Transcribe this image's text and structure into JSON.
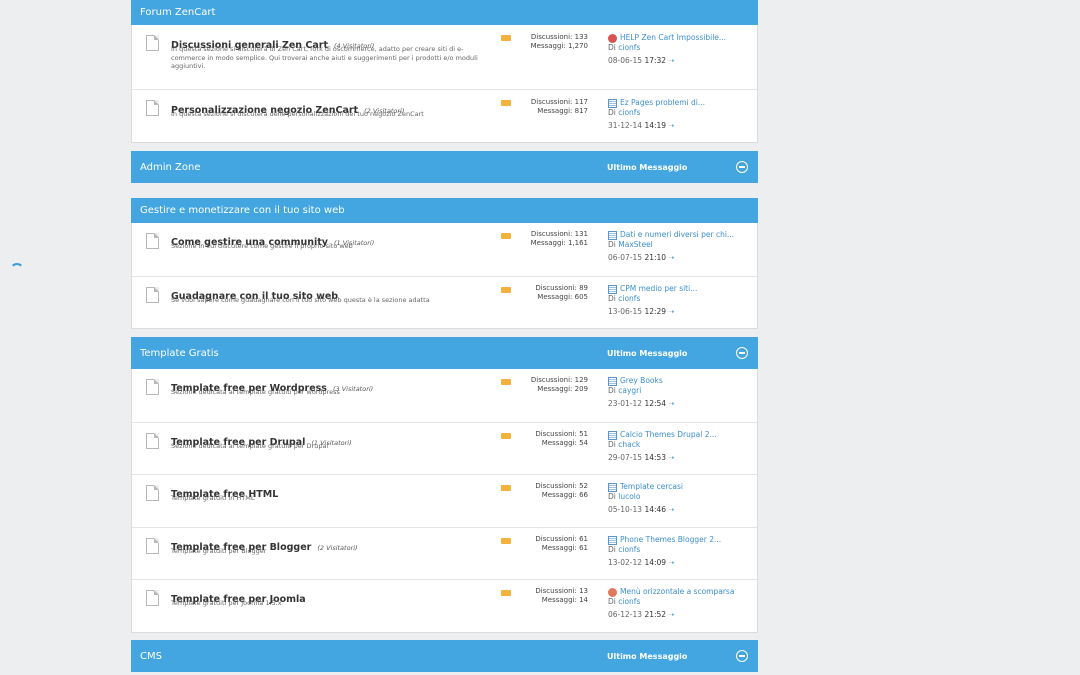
{
  "sections": [
    {
      "title": "Forum ZenCart",
      "last_label": "",
      "forums": [
        {
          "name": "Discussioni generali Zen Cart",
          "visitors": "(4 Visitatori)",
          "desc": "In questa sezione si discuterà di Zen Cart, fork di oscommerce, adatto per creare siti di e-commerce in modo semplice. Qui troverai anche aiuti e suggerimenti per i prodotti e/o moduli aggiuntivi.",
          "discussions": "Discussioni: 133",
          "messages": "Messaggi: 1,270",
          "last_icon": "alert-icon",
          "last_title": "HELP Zen Cart Impossibile...",
          "last_by_prefix": "Di",
          "last_user": "cionfs",
          "last_date": "08-06-15",
          "last_time": "17:32"
        },
        {
          "name": "Personalizzazione negozio ZenCart",
          "visitors": "(2 Visitatori)",
          "desc": "In questa sezione si discuterà delle personalizzazioni del tuo negozio ZenCart",
          "discussions": "Discussioni: 117",
          "messages": "Messaggi: 817",
          "last_icon": "document-icon",
          "last_title": "Ez Pages problemi di...",
          "last_by_prefix": "Di",
          "last_user": "cionfs",
          "last_date": "31-12-14",
          "last_time": "14:19"
        }
      ]
    },
    {
      "title": "Admin Zone",
      "last_label": "Ultimo Messaggio",
      "forums": []
    },
    {
      "title": "Gestire e monetizzare con il tuo sito web",
      "last_label": "",
      "forums": [
        {
          "name": "Come gestire una community",
          "visitors": "(1 Visitatori)",
          "desc": "Sezione in cui discutere come gestire il proprio sito web",
          "discussions": "Discussioni: 131",
          "messages": "Messaggi: 1,161",
          "last_icon": "document-icon",
          "last_title": "Dati e numeri diversi per chi...",
          "last_by_prefix": "Di",
          "last_user": "MaxSteel",
          "last_date": "06-07-15",
          "last_time": "21:10"
        },
        {
          "name": "Guadagnare con il tuo sito web",
          "visitors": "",
          "desc": "Se vuoi sapere come guadagnare con il tuo sito web questa è la sezione adatta",
          "discussions": "Discussioni: 89",
          "messages": "Messaggi: 605",
          "last_icon": "document-icon",
          "last_title": "CPM medio per siti...",
          "last_by_prefix": "Di",
          "last_user": "cionfs",
          "last_date": "13-06-15",
          "last_time": "12:29"
        }
      ]
    },
    {
      "title": "Template Gratis",
      "last_label": "Ultimo Messaggio",
      "forums": [
        {
          "name": "Template free per Wordpress",
          "visitors": "(3 Visitatori)",
          "desc": "Sezione dedicata ai template gratuiti per wordpress",
          "discussions": "Discussioni: 129",
          "messages": "Messaggi: 209",
          "last_icon": "document-icon",
          "last_title": "Grey Books",
          "last_by_prefix": "Di",
          "last_user": "caygri",
          "last_date": "23-01-12",
          "last_time": "12:54"
        },
        {
          "name": "Template free per Drupal",
          "visitors": "(1 Visitatori)",
          "desc": "Sezione dedicata ai template gratuiti per Drupal",
          "discussions": "Discussioni: 51",
          "messages": "Messaggi: 54",
          "last_icon": "document-icon",
          "last_title": "Calcio Themes Drupal 2...",
          "last_by_prefix": "Di",
          "last_user": "chack",
          "last_date": "29-07-15",
          "last_time": "14:53"
        },
        {
          "name": "Template free HTML",
          "visitors": "",
          "desc": "Template gratuiti in HTML",
          "discussions": "Discussioni: 52",
          "messages": "Messaggi: 66",
          "last_icon": "document-icon",
          "last_title": "Template cercasi",
          "last_by_prefix": "Di",
          "last_user": "lucolo",
          "last_date": "05-10-13",
          "last_time": "14:46"
        },
        {
          "name": "Template free per Blogger",
          "visitors": "(2 Visitatori)",
          "desc": "Template gratuiti per Blogger",
          "discussions": "Discussioni: 61",
          "messages": "Messaggi: 61",
          "last_icon": "document-icon",
          "last_title": "Phone Themes Blogger 2...",
          "last_by_prefix": "Di",
          "last_user": "cionfs",
          "last_date": "13-02-12",
          "last_time": "14:09"
        },
        {
          "name": "Template free per Joomla",
          "visitors": "",
          "desc": "Template gratuiti per Joomla 1.5.x",
          "discussions": "Discussioni: 13",
          "messages": "Messaggi: 14",
          "last_icon": "heart-icon",
          "last_title": "Menù orizzontale a scomparsa",
          "last_by_prefix": "Di",
          "last_user": "cionfs",
          "last_date": "06-12-13",
          "last_time": "21:52"
        }
      ]
    },
    {
      "title": "CMS",
      "last_label": "Ultimo Messaggio",
      "forums": []
    }
  ]
}
